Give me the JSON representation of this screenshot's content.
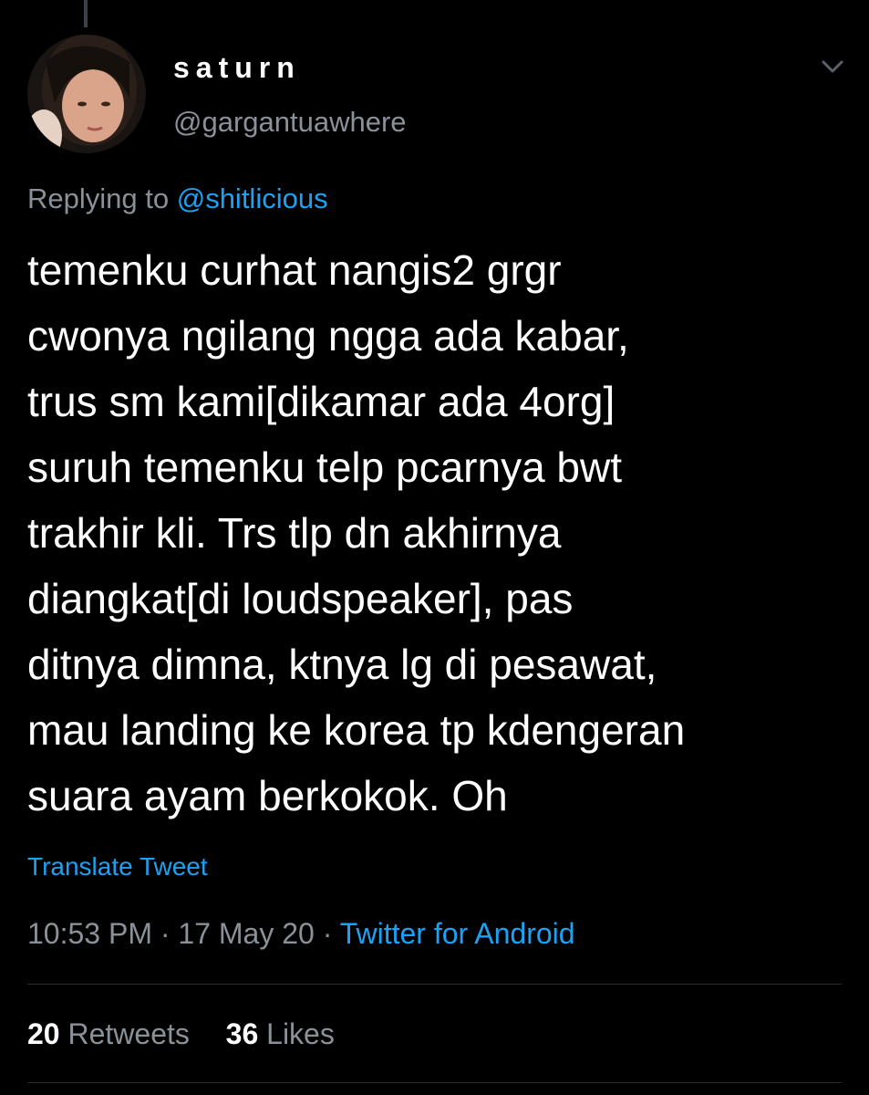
{
  "author": {
    "display_name": "saturn",
    "handle": "@gargantuawhere"
  },
  "reply": {
    "prefix": "Replying to",
    "mention": "@shitlicious"
  },
  "tweet": {
    "lines": [
      "temenku curhat nangis2 grgr",
      "cwonya ngilang ngga ada kabar,",
      "trus sm kami[dikamar ada 4org]",
      "suruh temenku telp pcarnya bwt",
      "trakhir kli. Trs tlp dn akhirnya",
      "diangkat[di loudspeaker], pas",
      "ditnya dimna, ktnya lg di pesawat,",
      "mau landing ke korea tp kdengeran",
      "suara ayam berkokok. Oh"
    ]
  },
  "translate_label": "Translate Tweet",
  "meta": {
    "time": "10:53 PM",
    "separator": "·",
    "date": "17 May 20",
    "source": "Twitter for Android"
  },
  "stats": {
    "retweets_count": "20",
    "retweets_label": "Retweets",
    "likes_count": "36",
    "likes_label": "Likes"
  },
  "icons": {
    "more": "chevron-down-icon"
  },
  "colors": {
    "background": "#000000",
    "text": "#ffffff",
    "secondary": "#8a9199",
    "accent": "#1da1f2"
  }
}
